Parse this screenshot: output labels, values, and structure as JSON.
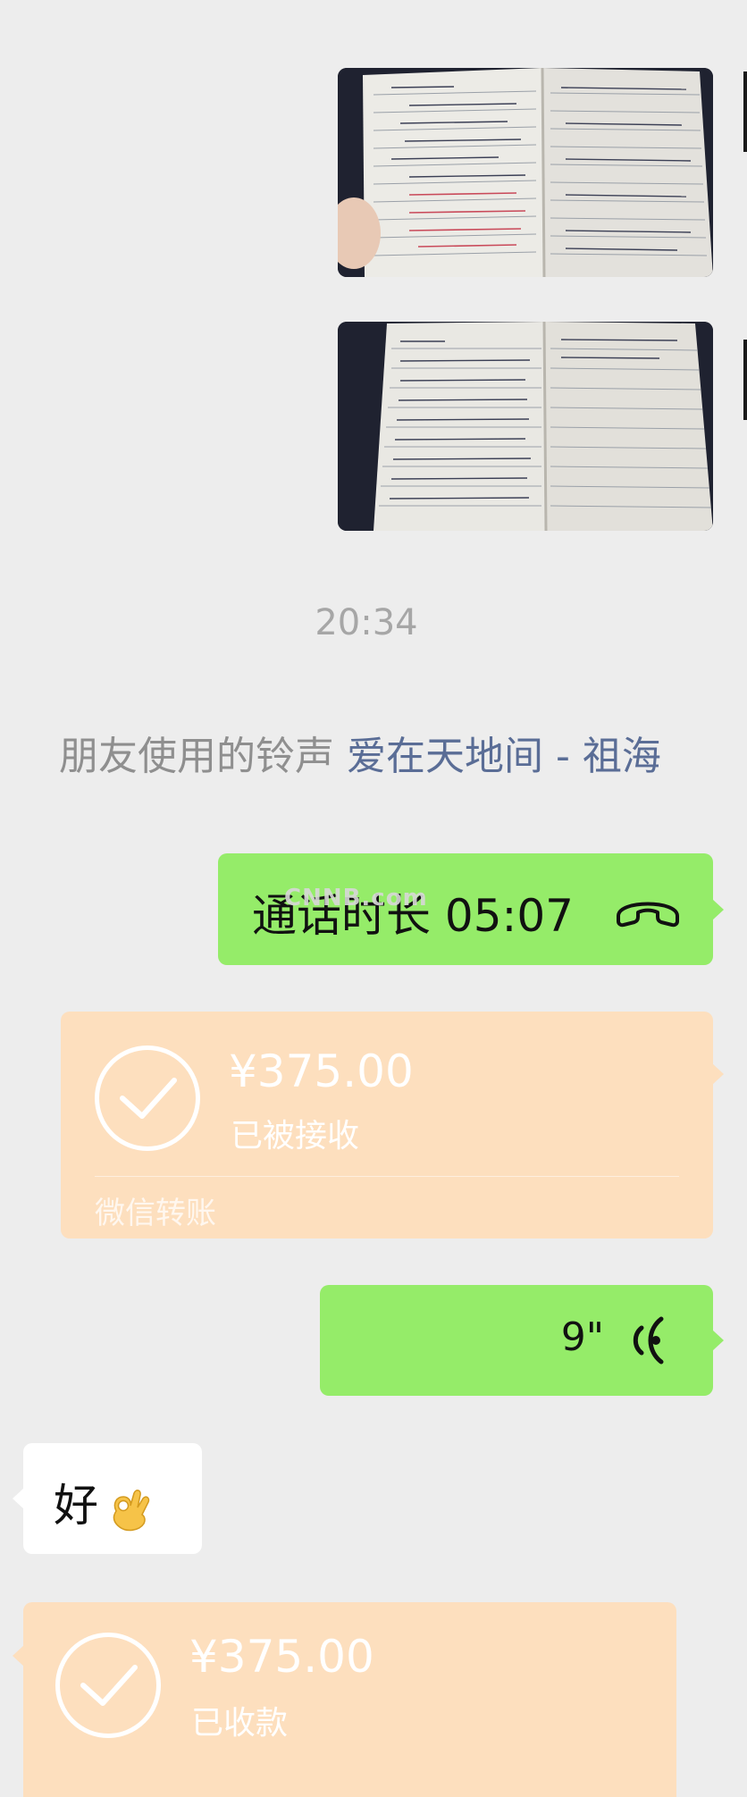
{
  "chat": {
    "timestamp": "20:34",
    "ringtone": {
      "prefix": "朋友使用的铃声 ",
      "song": "爱在天地间 - 祖海"
    },
    "call": {
      "label": "通话时长 05:07",
      "icon": "hangup-phone-icon"
    },
    "watermark": "CNNB.com",
    "transfer_sent": {
      "amount": "¥375.00",
      "status": "已被接收",
      "label": "微信转账",
      "icon": "check-icon"
    },
    "voice": {
      "duration": "9\"",
      "icon": "voice-wave-icon"
    },
    "text_reply": {
      "text": "好",
      "emoji": "ok-hand-emoji"
    },
    "transfer_received": {
      "amount": "¥375.00",
      "status": "已收款",
      "icon": "check-icon"
    }
  },
  "colors": {
    "background": "#ededed",
    "sent_bubble": "#95ec69",
    "received_bubble": "#ffffff",
    "transfer_card": "#fddfbe",
    "link": "#5a6d96",
    "system_text": "#8f8f8f"
  }
}
